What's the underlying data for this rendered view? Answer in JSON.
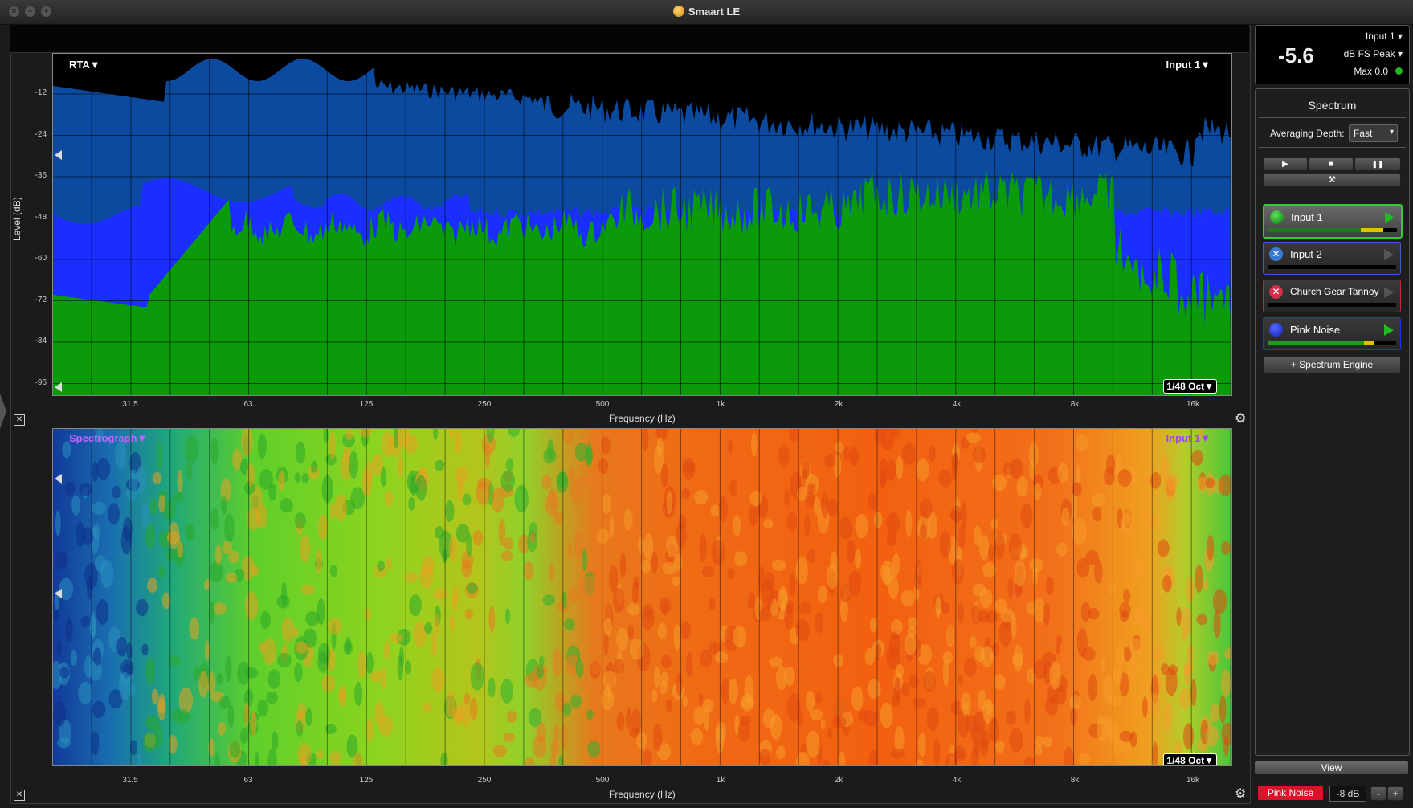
{
  "window": {
    "title": "Smaart LE",
    "traffic_lights": [
      "×",
      "–",
      "+"
    ]
  },
  "rta": {
    "mode_label": "RTA▼",
    "input_label": "Input 1▼",
    "octave_label": "1/48 Oct▼",
    "y_axis_title": "Level (dB)",
    "y_ticks": [
      "-12",
      "-24",
      "-36",
      "-48",
      "-60",
      "-72",
      "-84",
      "-96"
    ],
    "x_ticks": [
      "31.5",
      "63",
      "125",
      "250",
      "500",
      "1k",
      "2k",
      "4k",
      "8k",
      "16k"
    ],
    "x_axis_title": "Frequency (Hz)",
    "colors": {
      "trace_blue": "#0b4a9e",
      "trace_bright_blue": "#1a2fff",
      "trace_green": "#0a9a0a"
    }
  },
  "spectrograph": {
    "mode_label": "Spectrograph▼",
    "input_label": "Input 1▼",
    "octave_label": "1/48 Oct▼",
    "x_ticks": [
      "31.5",
      "63",
      "125",
      "250",
      "500",
      "1k",
      "2k",
      "4k",
      "8k",
      "16k"
    ],
    "x_axis_title": "Frequency (Hz)"
  },
  "level_meter": {
    "input_select": "Input 1",
    "value": "-5.6",
    "unit_select": "dB FS Peak",
    "max_label": "Max 0.0",
    "status_color": "#1fb81f"
  },
  "panel": {
    "title": "Spectrum",
    "averaging_label": "Averaging Depth:",
    "averaging_value": "Fast",
    "transport": {
      "play": "▶",
      "stop": "■",
      "pause": "❚❚",
      "tools": "⚒"
    },
    "inputs": [
      {
        "label": "Input 1",
        "state": "active",
        "color": "#1fa81f"
      },
      {
        "label": "Input 2",
        "state": "off",
        "color": "#3a7bd5"
      },
      {
        "label": "Church Gear Tannoy",
        "state": "off",
        "color": "#d0304a"
      },
      {
        "label": "Pink Noise",
        "state": "on",
        "color": "#2233ee"
      }
    ],
    "add_engine_label": "+ Spectrum Engine",
    "view_label": "View"
  },
  "generator": {
    "label": "Pink Noise",
    "level": "-8 dB",
    "minus": "-",
    "plus": "+"
  }
}
